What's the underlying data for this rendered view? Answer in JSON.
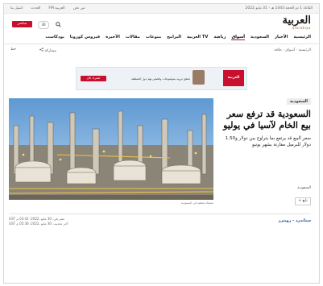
{
  "topbar": {
    "date": "الثلاثاء 1 ذو الحجة 1443 هـ - 31 مايو 2022",
    "links": [
      "من نحن",
      "العربية FM",
      "الحدث",
      "اتصل بنا"
    ]
  },
  "header": {
    "logo_ar": "العربية",
    "logo_en": "alarabiya",
    "live_label": "مباشر",
    "badge_label": "30",
    "search_icon": "search-icon"
  },
  "nav": {
    "items": [
      "الرئيسية",
      "الأخبار",
      "السعودية",
      "أسواق",
      "رياضة",
      "العربية TV",
      "البرامج",
      "منوعات",
      "مقالات",
      "الأخيرة",
      "فيروس كورونا",
      "بودكاست"
    ]
  },
  "breadcrumb": "الرئيسية · أسواق · طاقة",
  "toolbar": {
    "share_label": "مشاركة",
    "font_label": "خط"
  },
  "ad": {
    "logo_text": "العربية",
    "text": "تحقق تزويد بموضوعات وقصص تهم دول المنطقة",
    "button": "اشترك الآن"
  },
  "article": {
    "category": "السعودية",
    "headline": "السعودية قد ترفع سعر بيع الخام لآسيا في يوليو",
    "summary": "سعر البيع قد يرتفع بما يتراوح بين دولار و1.50 دولار للبرميل مقارنة بشهر يونيو",
    "image_caption": "مصفاة نفطية في السعودية",
    "tag": "السعودية",
    "follow_label": "+ تابع",
    "source": "ستاندرد - رويترز",
    "published": "نشر في: 30 مايو ,2022: 03:41 م GST",
    "updated": "آخر تحديث: 30 مايو ,2022: 05:36 م GST"
  },
  "colors": {
    "accent": "#c8102e",
    "link": "#1a4d8f"
  }
}
